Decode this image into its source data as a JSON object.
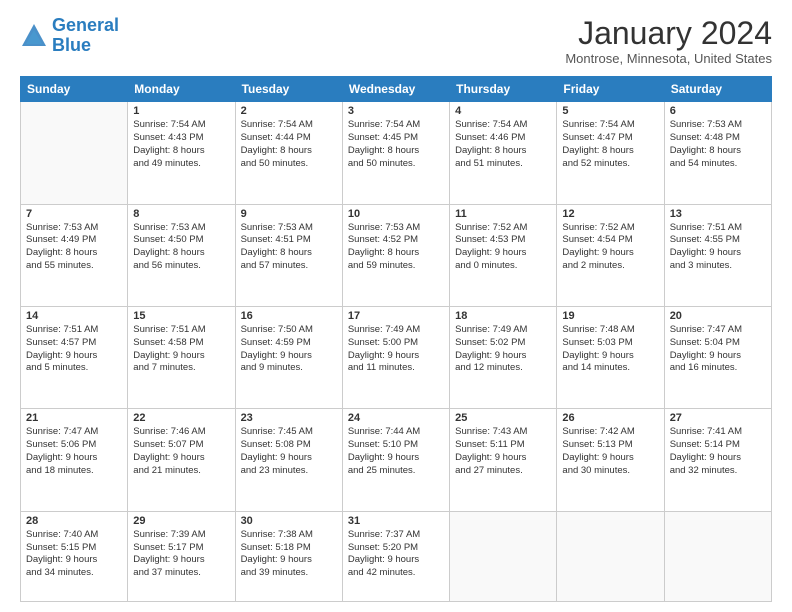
{
  "logo": {
    "line1": "General",
    "line2": "Blue"
  },
  "title": "January 2024",
  "location": "Montrose, Minnesota, United States",
  "weekdays": [
    "Sunday",
    "Monday",
    "Tuesday",
    "Wednesday",
    "Thursday",
    "Friday",
    "Saturday"
  ],
  "weeks": [
    [
      {
        "day": "",
        "info": ""
      },
      {
        "day": "1",
        "info": "Sunrise: 7:54 AM\nSunset: 4:43 PM\nDaylight: 8 hours\nand 49 minutes."
      },
      {
        "day": "2",
        "info": "Sunrise: 7:54 AM\nSunset: 4:44 PM\nDaylight: 8 hours\nand 50 minutes."
      },
      {
        "day": "3",
        "info": "Sunrise: 7:54 AM\nSunset: 4:45 PM\nDaylight: 8 hours\nand 50 minutes."
      },
      {
        "day": "4",
        "info": "Sunrise: 7:54 AM\nSunset: 4:46 PM\nDaylight: 8 hours\nand 51 minutes."
      },
      {
        "day": "5",
        "info": "Sunrise: 7:54 AM\nSunset: 4:47 PM\nDaylight: 8 hours\nand 52 minutes."
      },
      {
        "day": "6",
        "info": "Sunrise: 7:53 AM\nSunset: 4:48 PM\nDaylight: 8 hours\nand 54 minutes."
      }
    ],
    [
      {
        "day": "7",
        "info": "Sunrise: 7:53 AM\nSunset: 4:49 PM\nDaylight: 8 hours\nand 55 minutes."
      },
      {
        "day": "8",
        "info": "Sunrise: 7:53 AM\nSunset: 4:50 PM\nDaylight: 8 hours\nand 56 minutes."
      },
      {
        "day": "9",
        "info": "Sunrise: 7:53 AM\nSunset: 4:51 PM\nDaylight: 8 hours\nand 57 minutes."
      },
      {
        "day": "10",
        "info": "Sunrise: 7:53 AM\nSunset: 4:52 PM\nDaylight: 8 hours\nand 59 minutes."
      },
      {
        "day": "11",
        "info": "Sunrise: 7:52 AM\nSunset: 4:53 PM\nDaylight: 9 hours\nand 0 minutes."
      },
      {
        "day": "12",
        "info": "Sunrise: 7:52 AM\nSunset: 4:54 PM\nDaylight: 9 hours\nand 2 minutes."
      },
      {
        "day": "13",
        "info": "Sunrise: 7:51 AM\nSunset: 4:55 PM\nDaylight: 9 hours\nand 3 minutes."
      }
    ],
    [
      {
        "day": "14",
        "info": "Sunrise: 7:51 AM\nSunset: 4:57 PM\nDaylight: 9 hours\nand 5 minutes."
      },
      {
        "day": "15",
        "info": "Sunrise: 7:51 AM\nSunset: 4:58 PM\nDaylight: 9 hours\nand 7 minutes."
      },
      {
        "day": "16",
        "info": "Sunrise: 7:50 AM\nSunset: 4:59 PM\nDaylight: 9 hours\nand 9 minutes."
      },
      {
        "day": "17",
        "info": "Sunrise: 7:49 AM\nSunset: 5:00 PM\nDaylight: 9 hours\nand 11 minutes."
      },
      {
        "day": "18",
        "info": "Sunrise: 7:49 AM\nSunset: 5:02 PM\nDaylight: 9 hours\nand 12 minutes."
      },
      {
        "day": "19",
        "info": "Sunrise: 7:48 AM\nSunset: 5:03 PM\nDaylight: 9 hours\nand 14 minutes."
      },
      {
        "day": "20",
        "info": "Sunrise: 7:47 AM\nSunset: 5:04 PM\nDaylight: 9 hours\nand 16 minutes."
      }
    ],
    [
      {
        "day": "21",
        "info": "Sunrise: 7:47 AM\nSunset: 5:06 PM\nDaylight: 9 hours\nand 18 minutes."
      },
      {
        "day": "22",
        "info": "Sunrise: 7:46 AM\nSunset: 5:07 PM\nDaylight: 9 hours\nand 21 minutes."
      },
      {
        "day": "23",
        "info": "Sunrise: 7:45 AM\nSunset: 5:08 PM\nDaylight: 9 hours\nand 23 minutes."
      },
      {
        "day": "24",
        "info": "Sunrise: 7:44 AM\nSunset: 5:10 PM\nDaylight: 9 hours\nand 25 minutes."
      },
      {
        "day": "25",
        "info": "Sunrise: 7:43 AM\nSunset: 5:11 PM\nDaylight: 9 hours\nand 27 minutes."
      },
      {
        "day": "26",
        "info": "Sunrise: 7:42 AM\nSunset: 5:13 PM\nDaylight: 9 hours\nand 30 minutes."
      },
      {
        "day": "27",
        "info": "Sunrise: 7:41 AM\nSunset: 5:14 PM\nDaylight: 9 hours\nand 32 minutes."
      }
    ],
    [
      {
        "day": "28",
        "info": "Sunrise: 7:40 AM\nSunset: 5:15 PM\nDaylight: 9 hours\nand 34 minutes."
      },
      {
        "day": "29",
        "info": "Sunrise: 7:39 AM\nSunset: 5:17 PM\nDaylight: 9 hours\nand 37 minutes."
      },
      {
        "day": "30",
        "info": "Sunrise: 7:38 AM\nSunset: 5:18 PM\nDaylight: 9 hours\nand 39 minutes."
      },
      {
        "day": "31",
        "info": "Sunrise: 7:37 AM\nSunset: 5:20 PM\nDaylight: 9 hours\nand 42 minutes."
      },
      {
        "day": "",
        "info": ""
      },
      {
        "day": "",
        "info": ""
      },
      {
        "day": "",
        "info": ""
      }
    ]
  ]
}
